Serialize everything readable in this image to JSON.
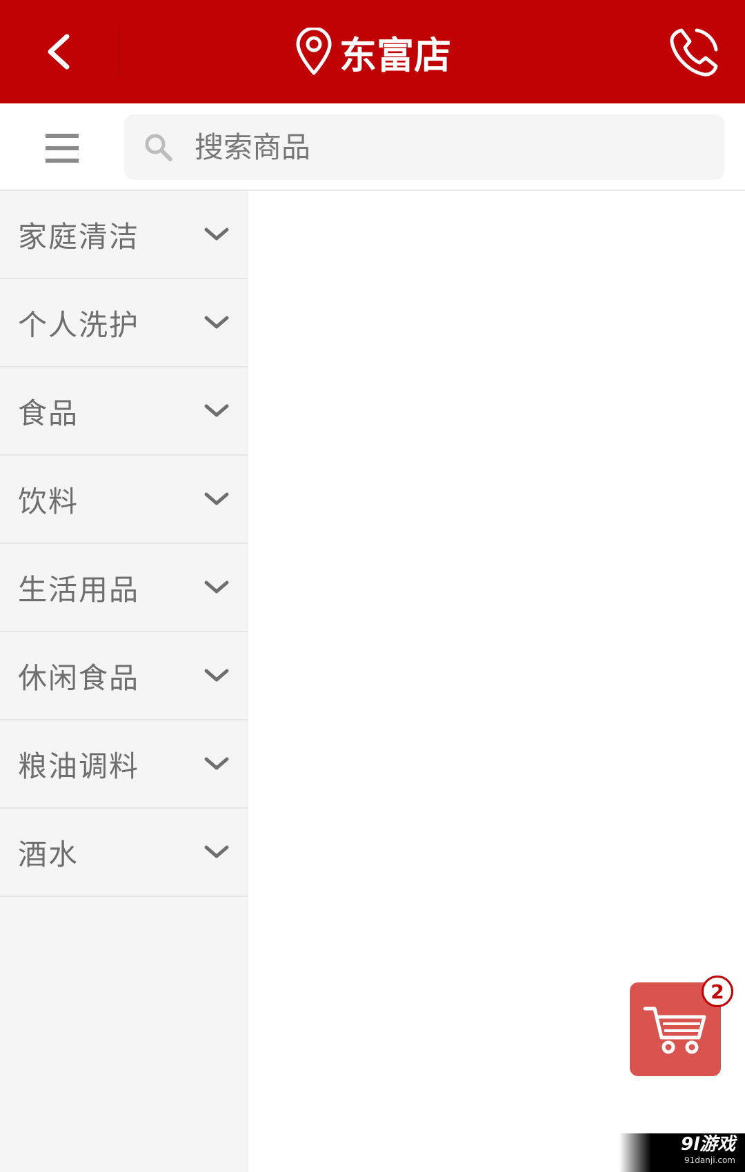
{
  "header": {
    "title": "东富店",
    "back_icon": "chevron-left-icon",
    "location_icon": "map-pin-icon",
    "phone_icon": "phone-icon",
    "background_color": "#c00205"
  },
  "search": {
    "placeholder": "搜索商品",
    "menu_icon": "hamburger-menu-icon",
    "search_icon": "search-icon"
  },
  "categories": [
    {
      "label": "家庭清洁"
    },
    {
      "label": "个人洗护"
    },
    {
      "label": "食品"
    },
    {
      "label": "饮料"
    },
    {
      "label": "生活用品"
    },
    {
      "label": "休闲食品"
    },
    {
      "label": "粮油调料"
    },
    {
      "label": "酒水"
    }
  ],
  "cart": {
    "count": "2",
    "icon": "shopping-cart-icon",
    "color": "#d9534f"
  },
  "watermark": {
    "logo": "9l游戏",
    "url": "91danji.com"
  }
}
